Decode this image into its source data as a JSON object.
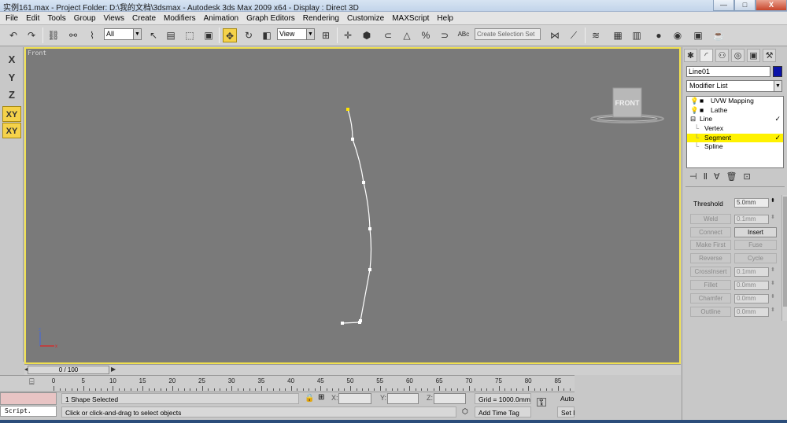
{
  "window": {
    "title": "实例161.max    - Project Folder: D:\\我的文档\\3dsmax    - Autodesk 3ds Max  2009 x64     - Display : Direct 3D",
    "minimize": "—",
    "maximize": "□",
    "close": "X"
  },
  "menu": [
    "File",
    "Edit",
    "Tools",
    "Group",
    "Views",
    "Create",
    "Modifiers",
    "Animation",
    "Graph Editors",
    "Rendering",
    "Customize",
    "MAXScript",
    "Help"
  ],
  "toolbar": {
    "selection_filter": "All",
    "reference_coord": "View",
    "named_selection_placeholder": "Create Selection Set"
  },
  "axis_constraints": [
    "X",
    "Y",
    "Z",
    "XY",
    "XY"
  ],
  "viewport": {
    "label": "Front",
    "viewcube_label": "FRONT",
    "spline_points": [
      [
        442,
        139
      ],
      [
        448,
        177
      ],
      [
        462,
        232
      ],
      [
        470,
        291
      ],
      [
        470,
        343
      ],
      [
        458,
        408
      ],
      [
        457,
        410
      ],
      [
        435,
        411
      ]
    ]
  },
  "command_panel": {
    "object_name": "Line01",
    "object_color": "#0b13a8",
    "modifier_list": "Modifier List",
    "stack": [
      {
        "label": "UVW Mapping",
        "type": "modifier"
      },
      {
        "label": "Lathe",
        "type": "modifier"
      },
      {
        "label": "Line",
        "type": "base"
      },
      {
        "label": "Vertex",
        "type": "sub"
      },
      {
        "label": "Segment",
        "type": "sub",
        "selected": true
      },
      {
        "label": "Spline",
        "type": "sub"
      }
    ],
    "geometry": {
      "threshold_label": "Threshold",
      "threshold_value": "5.0mm",
      "weld_label": "Weld",
      "weld_value": "0.1mm",
      "connect": "Connect",
      "insert": "Insert",
      "make_first": "Make First",
      "fuse": "Fuse",
      "reverse": "Reverse",
      "cycle": "Cycle",
      "crossinsert": "CrossInsert",
      "crossinsert_value": "0.1mm",
      "fillet": "Fillet",
      "fillet_value": "0.0mm",
      "chamfer": "Chamfer",
      "chamfer_value": "0.0mm",
      "outline": "Outline",
      "outline_value": "0.0mm"
    }
  },
  "time": {
    "slider": "0 / 100",
    "ticks": [
      "0",
      "5",
      "10",
      "15",
      "20",
      "25",
      "30",
      "35",
      "40",
      "45",
      "50",
      "55",
      "60",
      "65",
      "70",
      "75",
      "80",
      "85"
    ]
  },
  "status": {
    "script_label": "Script.",
    "selection": "1 Shape Selected",
    "prompt": "Click or click-and-drag to select objects",
    "x_label": "X:",
    "y_label": "Y:",
    "z_label": "Z:",
    "grid": "Grid = 1000.0mm",
    "add_time_tag": "Add Time Tag",
    "auto": "Auto",
    "set": "Set I"
  }
}
